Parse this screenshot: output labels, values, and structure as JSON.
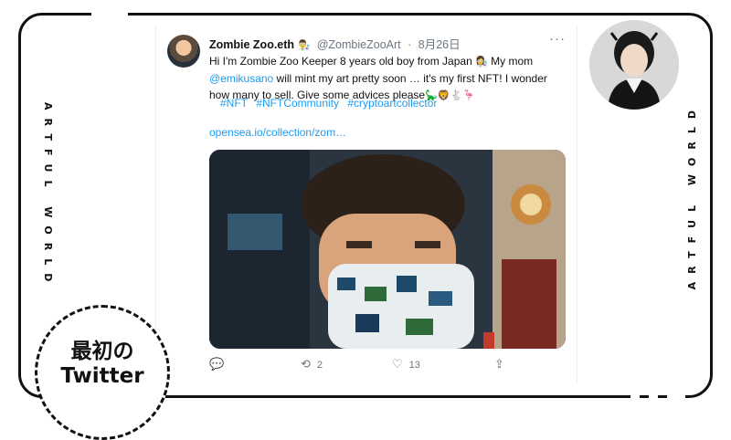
{
  "side_text": {
    "left": "ARTFUL WORLD",
    "right": "ARTFUL WORLD"
  },
  "caption": {
    "line1": "最初の",
    "line2": "Twitter"
  },
  "tweet": {
    "author_name": "Zombie Zoo.eth",
    "author_emoji": "👨‍🔬",
    "handle": "@ZombieZooArt",
    "separator": "·",
    "date": "8月26日",
    "more": "···",
    "text_part1": "Hi I'm Zombie Zoo Keeper 8 years old boy from Japan ",
    "text_emoji1": "👩‍🔬",
    "text_part2": " My mom ",
    "mention": "@emikusano",
    "text_part3": " will mint my art pretty soon … it's my first NFT! I wonder how many to sell. Give some advices please",
    "text_emoji2": "🦕🦁🐇🦩",
    "hashtags": [
      "#NFT",
      "#NFTCommunity",
      "#cryptoartcollector"
    ],
    "link": "opensea.io/collection/zom…",
    "actions": {
      "reply_icon": "reply-icon",
      "retweet_icon": "retweet-icon",
      "retweet_count": "2",
      "like_icon": "heart-icon",
      "like_count": "13",
      "share_icon": "share-icon"
    }
  },
  "colors": {
    "link": "#1d9bf0",
    "muted": "#6b7680",
    "frame": "#111111"
  }
}
